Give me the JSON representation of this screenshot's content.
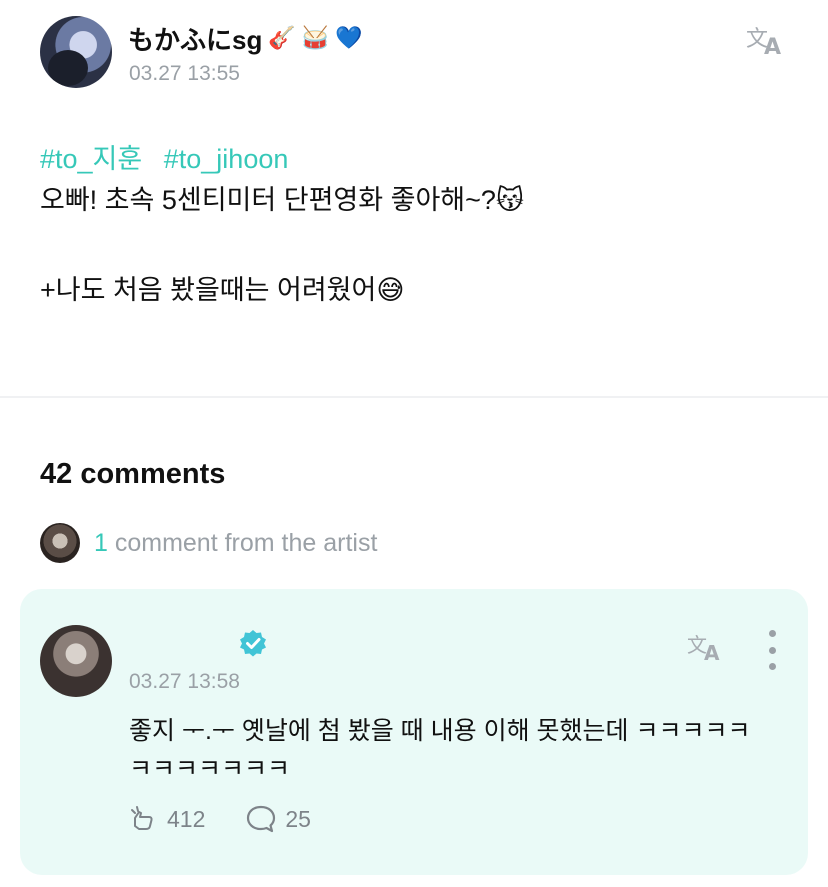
{
  "post": {
    "author": "もかふにsg",
    "author_emojis": [
      "🎸",
      "🥁",
      "💙"
    ],
    "timestamp": "03.27 13:55",
    "hashtags": [
      "#to_지훈",
      "#to_jihoon"
    ],
    "line1": "오빠! 초속 5센티미터 단편영화 좋아해~?😽",
    "line2": "+나도 처음 봤을때는 어려웠어😅"
  },
  "comments": {
    "count_label": "42 comments",
    "artist_count": "1",
    "artist_label": " comment from the artist"
  },
  "artist_comment": {
    "timestamp": "03.27 13:58",
    "text": "좋지 ᅮ.ᅮ 옛날에 첨 봤을 때 내용 이해 못했는데 ㅋㅋㅋㅋㅋㅋㅋㅋㅋㅋㅋㅋ",
    "likes": "412",
    "replies": "25"
  },
  "colors": {
    "accent": "#36c8b8",
    "card_bg": "#eafaf7",
    "muted": "#9aa0a6"
  },
  "icons": {
    "translate": "translate-icon",
    "verified": "verified-badge-icon",
    "more": "more-vertical-icon",
    "like": "like-hand-icon",
    "reply": "comment-bubble-icon"
  }
}
